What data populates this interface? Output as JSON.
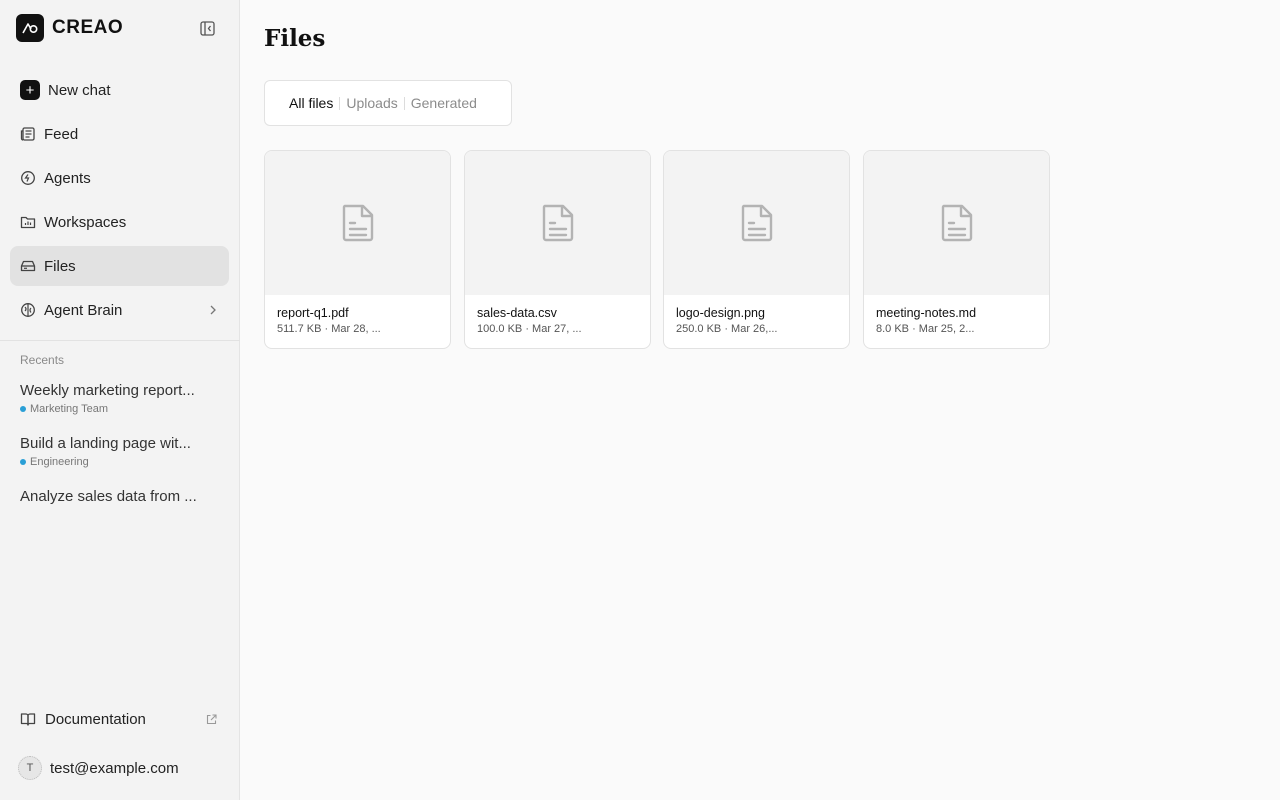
{
  "brand": {
    "name": "CREAO"
  },
  "nav": [
    {
      "label": "New chat",
      "icon": "plus-icon"
    },
    {
      "label": "Feed",
      "icon": "newspaper-icon"
    },
    {
      "label": "Agents",
      "icon": "agent-icon"
    },
    {
      "label": "Workspaces",
      "icon": "folder-chart-icon"
    },
    {
      "label": "Files",
      "icon": "drive-icon",
      "active": true
    },
    {
      "label": "Agent Brain",
      "icon": "brain-icon"
    }
  ],
  "recents": {
    "title": "Recents",
    "items": [
      {
        "title": "Weekly marketing report...",
        "tag": "Marketing Team"
      },
      {
        "title": "Build a landing page wit...",
        "tag": "Engineering"
      },
      {
        "title": "Analyze sales data from ..."
      }
    ]
  },
  "footer": {
    "documentation": "Documentation",
    "user_initial": "T",
    "user_email": "test@example.com"
  },
  "main": {
    "title": "Files",
    "tabs": [
      "All files",
      "Uploads",
      "Generated"
    ],
    "active_tab": "All files",
    "files": [
      {
        "name": "report-q1.pdf",
        "meta": "511.7 KB · Mar 28, ..."
      },
      {
        "name": "sales-data.csv",
        "meta": "100.0 KB · Mar 27, ..."
      },
      {
        "name": "logo-design.png",
        "meta": "250.0 KB · Mar 26,..."
      },
      {
        "name": "meeting-notes.md",
        "meta": "8.0 KB · Mar 25, 2..."
      }
    ]
  },
  "colors": {
    "sidebar_bg": "#f3f3f3",
    "active_item_bg": "#e2e2e2",
    "brand": "#111111",
    "recent_dot": "#2a9fd6"
  }
}
